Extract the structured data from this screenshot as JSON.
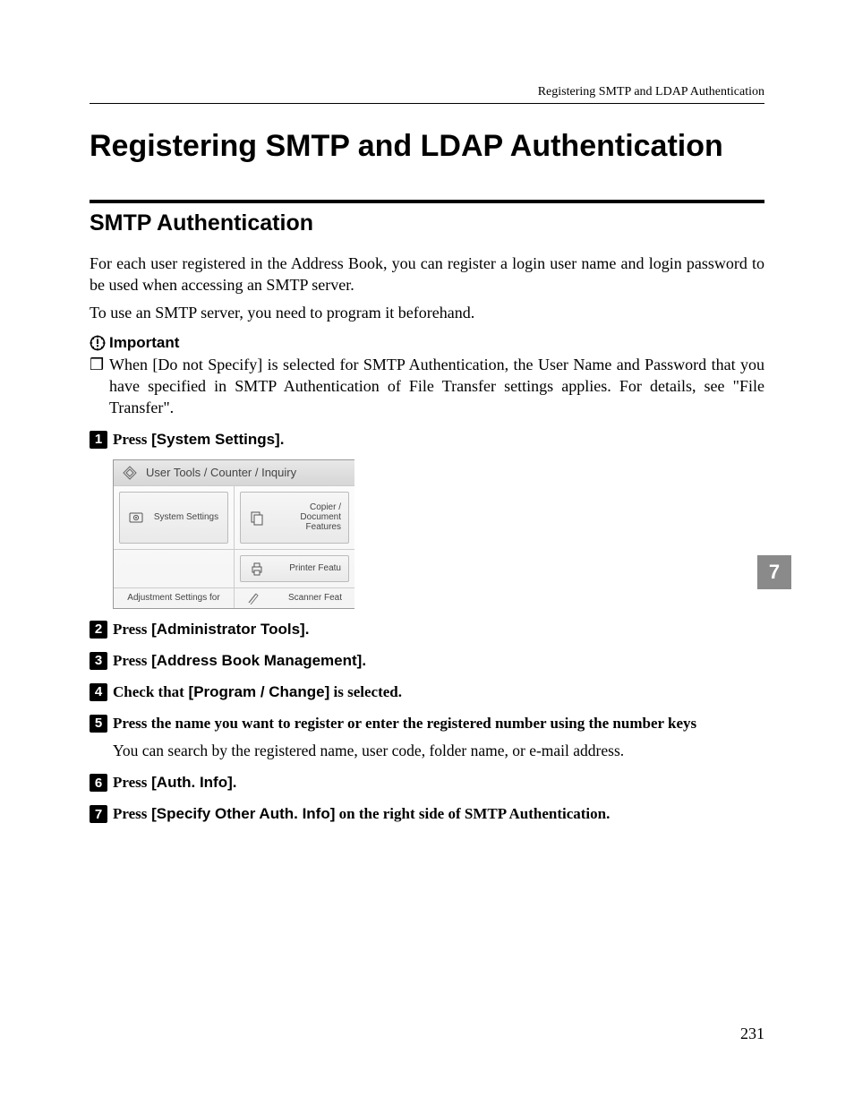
{
  "header": {
    "running": "Registering SMTP and LDAP Authentication"
  },
  "title": "Registering SMTP and LDAP Authentication",
  "section": "SMTP Authentication",
  "para1": "For each user registered in the Address Book, you can register a login user name and login password to be used when accessing an SMTP server.",
  "para2": "To use an SMTP server, you need to program it beforehand.",
  "important": {
    "label": "Important",
    "bullet": "When [Do not Specify] is selected for SMTP Authentication, the User Name and Password that you have specified in SMTP Authentication of File Transfer settings applies. For details, see \"File Transfer\"."
  },
  "steps": [
    {
      "press": "Press",
      "btn": " [System Settings].",
      "after": ""
    },
    {
      "press": "Press",
      "btn": " [Administrator Tools].",
      "after": ""
    },
    {
      "press": "Press",
      "btn": " [Address Book Management].",
      "after": ""
    },
    {
      "press": "Check that",
      "btn": " [Program / Change]",
      "after": " is selected."
    },
    {
      "press": "Press the name you want to register or enter the registered number using the number keys",
      "btn": "",
      "after": "",
      "note": "You can search by the registered name, user code, folder name, or e-mail address."
    },
    {
      "press": "Press",
      "btn": " [Auth. Info].",
      "after": ""
    },
    {
      "press": "Press",
      "btn": " [Specify Other Auth. Info]",
      "after": " on the right side of SMTP Authentication."
    }
  ],
  "screenshot": {
    "title": "User Tools / Counter / Inquiry",
    "tiles": {
      "system": "System Settings",
      "copier": "Copier / Document Features",
      "printer": "Printer Featu",
      "adjust": "Adjustment Settings for",
      "scanner": "Scanner Feat"
    }
  },
  "sidetab": "7",
  "pagenum": "231"
}
